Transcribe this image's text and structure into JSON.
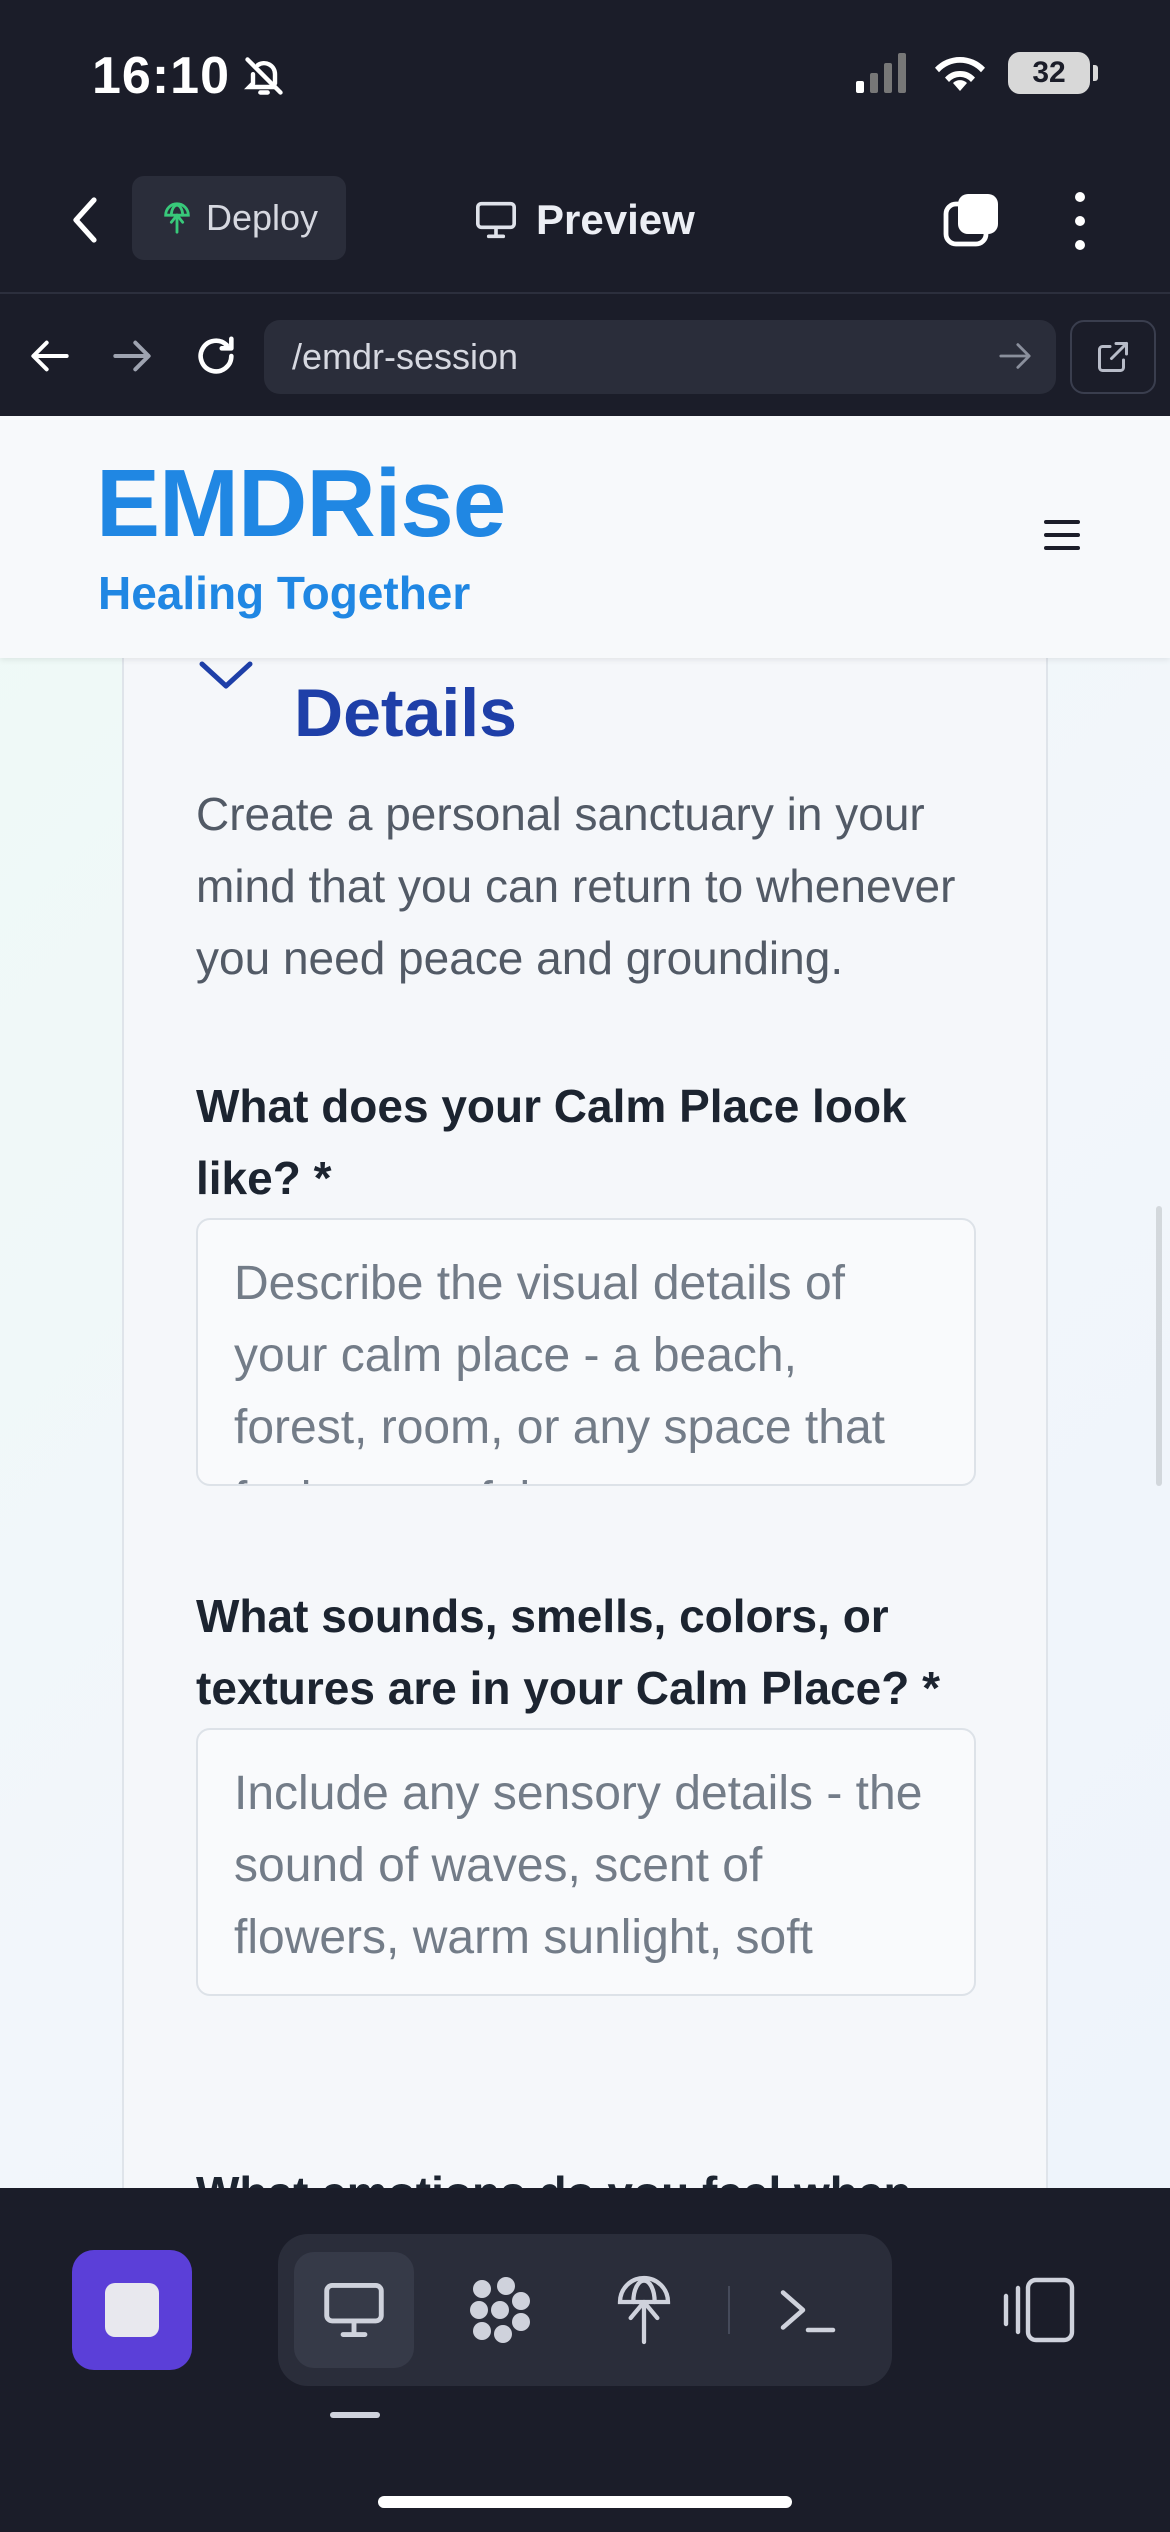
{
  "status_bar": {
    "time": "16:10",
    "battery": "32"
  },
  "app_header": {
    "deploy_label": "Deploy",
    "preview_label": "Preview"
  },
  "browser": {
    "url": "/emdr-session"
  },
  "site": {
    "brand": "EMDRise",
    "tagline": "Healing Together"
  },
  "card": {
    "title": "Details",
    "description": "Create a personal sanctuary in your mind that you can return to whenever you need peace and grounding.",
    "questions": [
      {
        "label": "What does your Calm Place look like? *",
        "placeholder": "Describe the visual details of your calm place - a beach, forest, room, or any space that feels peaceful to you"
      },
      {
        "label": "What sounds, smells, colors, or textures are in your Calm Place? *",
        "placeholder": "Include any sensory details - the sound of waves, scent of flowers, warm sunlight, soft"
      },
      {
        "label": "What emotions do you feel when"
      }
    ]
  },
  "colors": {
    "brand": "#2087e3",
    "title": "#1e3fa8",
    "stop": "#5b3fd8"
  }
}
